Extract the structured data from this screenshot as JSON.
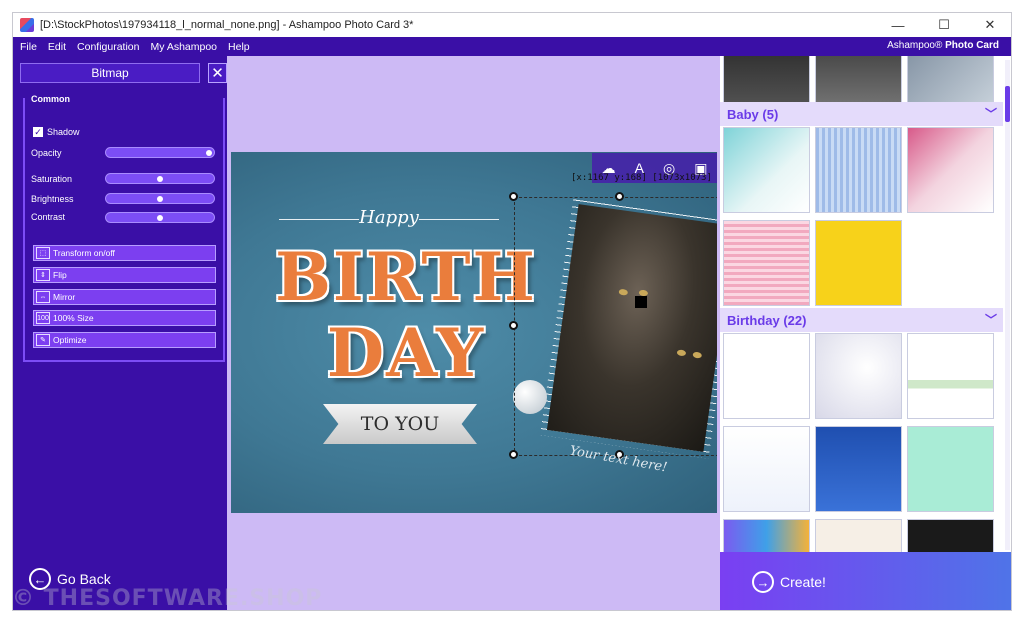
{
  "window": {
    "title": "[D:\\StockPhotos\\197934118_l_normal_none.png] - Ashampoo Photo Card 3*",
    "controls": [
      "minimize",
      "maximize",
      "close"
    ]
  },
  "menu": {
    "items": [
      "File",
      "Edit",
      "Configuration",
      "My Ashampoo",
      "Help"
    ],
    "brand": "Ashampoo®",
    "brand_product": "Photo Card"
  },
  "panel": {
    "title": "Bitmap",
    "close": "✕",
    "group_label": "Common",
    "shadow_label": "Shadow",
    "shadow_checked": true,
    "sliders": [
      {
        "label": "Opacity",
        "value": 1.0
      },
      {
        "label": "Saturation",
        "value": 0.5
      },
      {
        "label": "Brightness",
        "value": 0.5
      },
      {
        "label": "Contrast",
        "value": 0.5
      }
    ],
    "actions": [
      {
        "label": "Transform on/off",
        "icon": "transform-icon"
      },
      {
        "label": "Flip",
        "icon": "flip-icon"
      },
      {
        "label": "Mirror",
        "icon": "mirror-icon"
      },
      {
        "label": "100% Size",
        "icon": "100",
        "icon_text": "100"
      },
      {
        "label": "Optimize",
        "icon": "optimize-icon"
      }
    ],
    "go_back": "Go Back"
  },
  "card": {
    "coords": "[x:1167 y:168] [1073x1073]",
    "happy": "Happy",
    "birth": "BIRTH",
    "day": "DAY",
    "to_you": "TO YOU",
    "your_text": "Your text here!"
  },
  "gallery": {
    "categories": [
      {
        "label": "Baby (5)"
      },
      {
        "label": "Birthday (22)"
      }
    ]
  },
  "create": "Create!",
  "watermark": "© THESOFTWARE.SHOP",
  "colors": {
    "accent": "#3a0fa6",
    "highlight": "#7c3ff0",
    "canvas_bg": "#cdbaf5",
    "card_orange": "#ea7d3c"
  }
}
